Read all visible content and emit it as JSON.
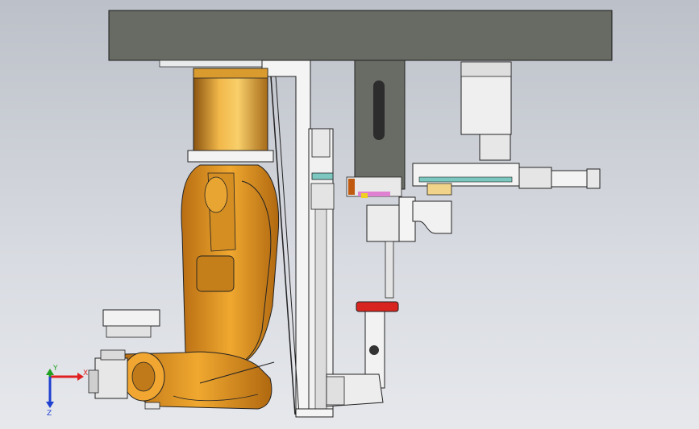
{
  "viewport": {
    "background_top": "#bcc0c8",
    "background_bottom": "#e6e8ec"
  },
  "colors": {
    "overhead_beam": "#676b63",
    "robot_body": "#e6a02a",
    "robot_shadow": "#b8741a",
    "frame_white": "#f4f4f4",
    "outline": "#1a1a1a",
    "red_fixture": "#d8241f",
    "axis_x": "#e02020",
    "axis_y": "#20a020",
    "axis_z": "#2040d0"
  },
  "triad": {
    "x_label": "X",
    "y_label": "Y",
    "z_label": "Z"
  }
}
